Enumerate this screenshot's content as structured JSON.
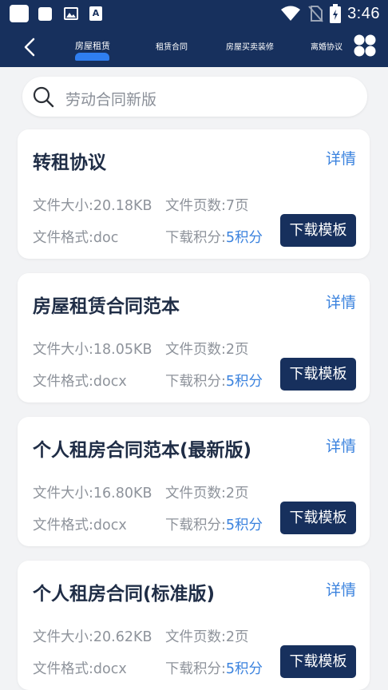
{
  "status_bar": {
    "time": "3:46",
    "icons": [
      "app-icon",
      "app-icon",
      "image-icon",
      "text-icon",
      "wifi-icon",
      "no-sim-icon",
      "battery-icon"
    ],
    "text_icon_letter": "A"
  },
  "nav": {
    "tabs": [
      {
        "label": "房屋租赁",
        "active": true
      },
      {
        "label": "租赁合同",
        "active": false
      },
      {
        "label": "房屋买卖装修",
        "active": false
      },
      {
        "label": "离婚协议",
        "active": false
      }
    ],
    "accent_color": "#2f7ef0",
    "header_color": "#17305d"
  },
  "search": {
    "placeholder": "劳动合同新版"
  },
  "cards": [
    {
      "title": "转租协议",
      "detail": "详情",
      "size": "文件大小:20.18KB",
      "pages": "文件页数:7页",
      "format": "文件格式:doc",
      "points_label": "下载积分:",
      "points_value": "5积分",
      "download": "下载模板"
    },
    {
      "title": "房屋租赁合同范本",
      "detail": "详情",
      "size": "文件大小:18.05KB",
      "pages": "文件页数:2页",
      "format": "文件格式:docx",
      "points_label": "下载积分:",
      "points_value": "5积分",
      "download": "下载模板"
    },
    {
      "title": "个人租房合同范本(最新版)",
      "detail": "详情",
      "size": "文件大小:16.80KB",
      "pages": "文件页数:2页",
      "format": "文件格式:docx",
      "points_label": "下载积分:",
      "points_value": "5积分",
      "download": "下载模板"
    },
    {
      "title": "个人租房合同(标准版)",
      "detail": "详情",
      "size": "文件大小:20.62KB",
      "pages": "文件页数:2页",
      "format": "文件格式:docx",
      "points_label": "下载积分:",
      "points_value": "5积分",
      "download": "下载模板"
    }
  ]
}
